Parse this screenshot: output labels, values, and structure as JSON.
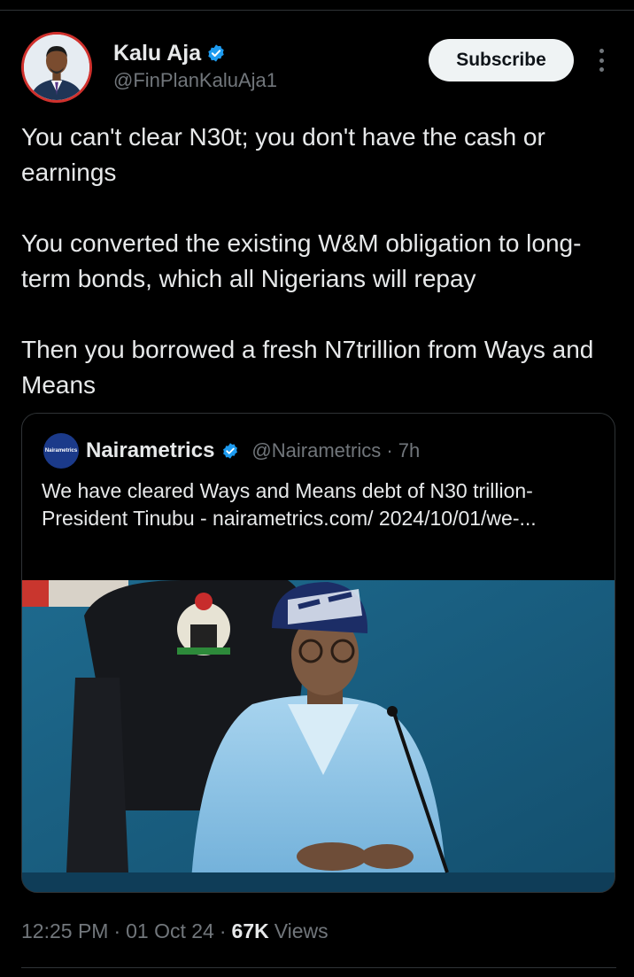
{
  "author": {
    "display_name": "Kalu Aja",
    "handle": "@FinPlanKaluAja1",
    "avatar_icon": "profile-photo",
    "verified_color": "#1d9bf0"
  },
  "actions": {
    "subscribe_label": "Subscribe",
    "more_icon": "vertical-ellipsis-icon"
  },
  "tweet": {
    "paragraphs": [
      "You can't clear N30t; you don't have the cash or earnings",
      "You converted the existing W&M obligation to long-term bonds, which all Nigerians will repay",
      "Then you borrowed a fresh N7trillion  from Ways and Means"
    ]
  },
  "quote": {
    "avatar_text": "Nairametrics",
    "display_name": "Nairametrics",
    "handle_time": "@Nairametrics · 7h",
    "text": "We have cleared Ways and Means debt of N30 trillion- President Tinubu  -  nairametrics.com/ 2024/10/01/we-...",
    "image_icon": "news-photo"
  },
  "meta": {
    "time": "12:25 PM",
    "sep1": "·",
    "date": "01 Oct 24",
    "sep2": "·",
    "views_count": "67K",
    "views_label": "Views"
  }
}
